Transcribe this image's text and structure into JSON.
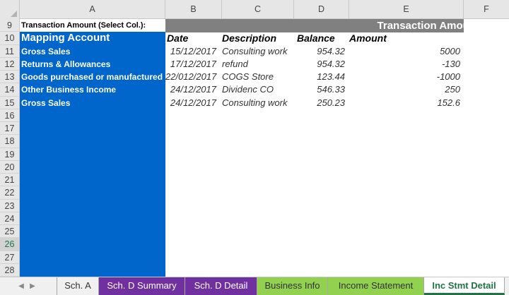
{
  "columns": [
    "A",
    "B",
    "C",
    "D",
    "E",
    "F"
  ],
  "row_numbers": [
    "9",
    "10",
    "11",
    "12",
    "13",
    "14",
    "15",
    "16",
    "17",
    "18",
    "19",
    "20",
    "21",
    "22",
    "23",
    "24",
    "25",
    "26",
    "27",
    "28"
  ],
  "selected_row": "26",
  "header_row": {
    "select_col_label": "Transaction Amount (Select Col.):",
    "transaction_amount_title": "Transaction Amount"
  },
  "mapping": {
    "title": "Mapping Account",
    "accounts": [
      "Gross Sales",
      "Returns & Allowances",
      "Goods purchased or manufactured",
      "Other Business Income",
      "Gross Sales"
    ]
  },
  "table": {
    "headers": {
      "date": "Date",
      "description": "Description",
      "balance": "Balance",
      "amount": "Amount"
    },
    "rows": [
      {
        "date": "15/12/2017",
        "description": "Consulting work",
        "balance": "954.32",
        "amount": "5000"
      },
      {
        "date": "17/12/2017",
        "description": "refund",
        "balance": "954.32",
        "amount": "-130"
      },
      {
        "date": "22/012/2017",
        "description": "COGS Store",
        "balance": "123.44",
        "amount": "-1000"
      },
      {
        "date": "24/12/2017",
        "description": "Dividenc CO",
        "balance": "546.33",
        "amount": "250"
      },
      {
        "date": "24/12/2017",
        "description": "Consulting work",
        "balance": "250.23",
        "amount": "152.6"
      }
    ]
  },
  "tabs": [
    {
      "label": "Sch. A",
      "color": "#f0f0f0"
    },
    {
      "label": "Sch. D Summary",
      "color": "#7030a0"
    },
    {
      "label": "Sch. D Detail",
      "color": "#7030a0"
    },
    {
      "label": "Business Info",
      "color": "#92d050"
    },
    {
      "label": "Income Statement",
      "color": "#92d050"
    },
    {
      "label": "Inc Stmt Detail",
      "color": "#ffffff"
    }
  ],
  "active_tab": "Inc Stmt Detail",
  "colors": {
    "mapping_blue": "#0066cc",
    "header_gray": "#808080",
    "excel_green": "#217346"
  }
}
